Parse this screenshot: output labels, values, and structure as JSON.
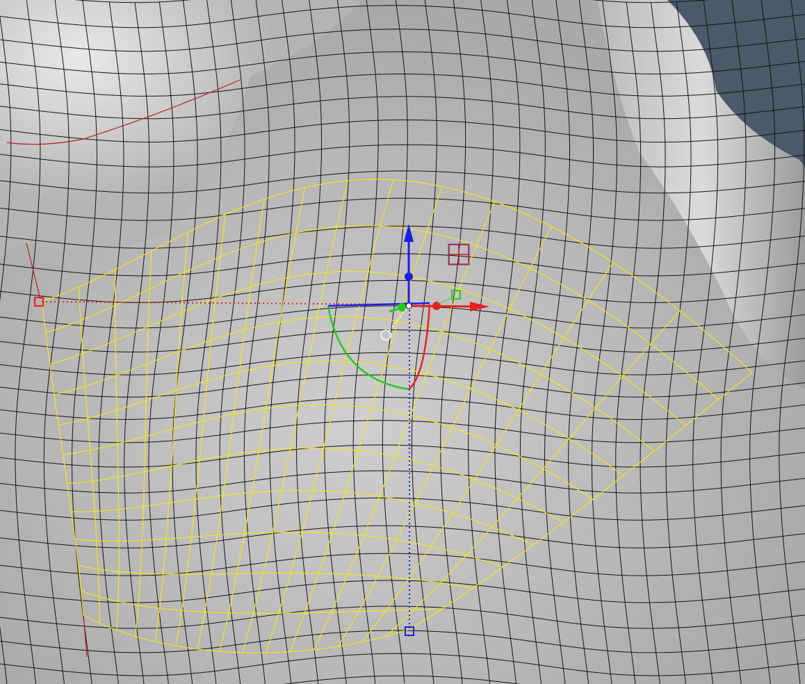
{
  "viewport": {
    "kind": "3D modeling viewport, shaded with wireframe",
    "background_color": "#4b5a69",
    "surface_color": "#c4c4c4",
    "mesh_wire_color": "#111111",
    "selection_color": "#f2e41a",
    "seam_color": "#b81e1e"
  },
  "selected_patch": {
    "rows": 11,
    "columns": 15,
    "highlight": "yellow"
  },
  "gizmo": {
    "name": "transform gizmo",
    "axes": [
      {
        "axis": "X",
        "color": "#e82020"
      },
      {
        "axis": "Y",
        "color": "#20c020"
      },
      {
        "axis": "Z",
        "color": "#1e1ee6"
      }
    ],
    "handles": [
      "translate-arrow",
      "rotate-arc",
      "scale-dot",
      "plane-handle"
    ]
  },
  "snap_markers": [
    {
      "name": "edge-snap-x",
      "color": "#e02020",
      "style": "dotted"
    },
    {
      "name": "edge-snap-z",
      "color": "#2020e0",
      "style": "dotted"
    }
  ]
}
